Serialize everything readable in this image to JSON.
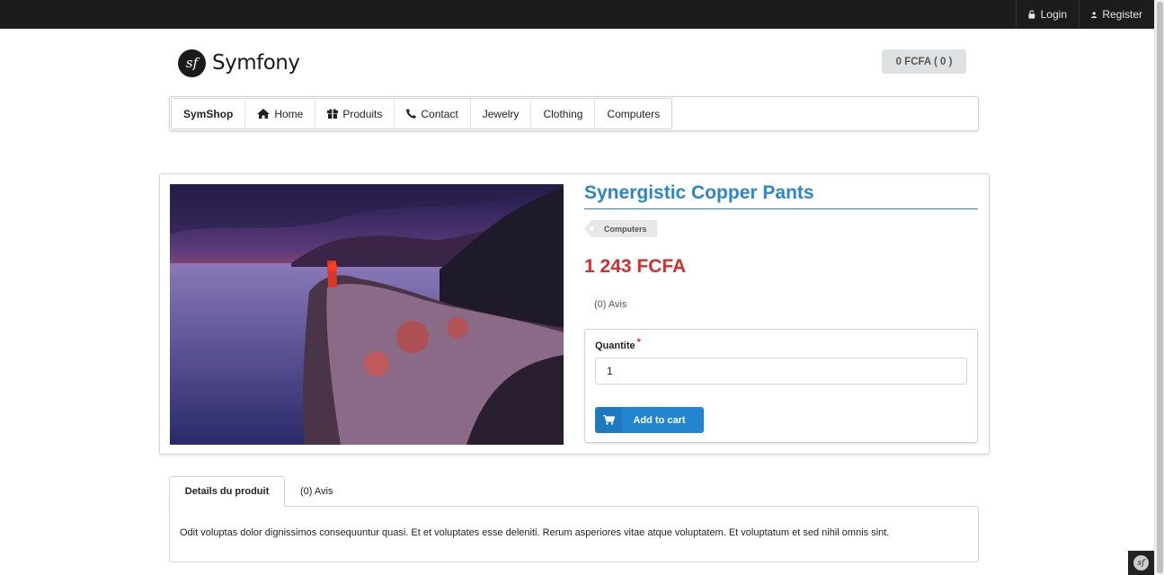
{
  "topbar": {
    "login_label": "Login",
    "register_label": "Register",
    "login_icon": "lock-icon",
    "register_icon": "user-icon"
  },
  "header": {
    "logo_mark": "sf",
    "logo_text": "Symfony",
    "cart_label": "0 FCFA ( 0 )"
  },
  "menu": {
    "brand": "SymShop",
    "items": [
      {
        "label": "Home",
        "icon": "home-icon"
      },
      {
        "label": "Produits",
        "icon": "gift-icon"
      },
      {
        "label": "Contact",
        "icon": "phone-icon"
      },
      {
        "label": "Jewelry"
      },
      {
        "label": "Clothing"
      },
      {
        "label": "Computers"
      }
    ]
  },
  "product": {
    "title": "Synergistic Copper Pants",
    "category_tag": "Computers",
    "price": "1 243 FCFA",
    "reviews": "(0) Avis",
    "quantity_label": "Quantite",
    "required_mark": "*",
    "quantity_value": "1",
    "add_to_cart_label": "Add to cart",
    "add_to_cart_icon": "cart-icon"
  },
  "tabs": {
    "details_label": "Details du produit",
    "reviews_label": "(0) Avis"
  },
  "description": "Odit voluptas dolor dignissimos consequuntur quasi. Et et voluptates esse deleniti. Rerum asperiores vitae atque voluptatem. Et voluptatum et sed nihil omnis sint.",
  "debug_badge": "sf",
  "colors": {
    "topbar": "#1b1c1d",
    "title_blue": "#2a86c9",
    "price_red": "#d42d2d",
    "button_blue": "#2185d0"
  }
}
